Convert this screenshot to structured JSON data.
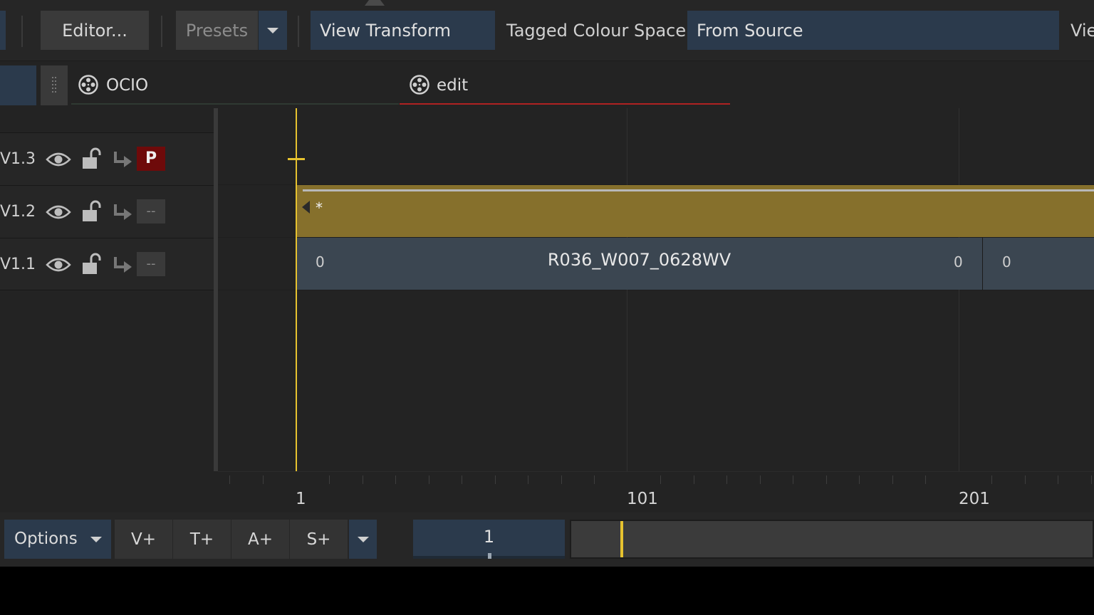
{
  "toolbar": {
    "editor_label": "Editor...",
    "presets_label": "Presets",
    "view_transform_value": "View Transform",
    "tagged_colour_space_label": "Tagged Colour Space",
    "tagged_colour_space_value": "From Source",
    "view_label_cut": "Vie"
  },
  "tabs": [
    {
      "label": "OCIO",
      "icon": "film-reel-icon"
    },
    {
      "label": "edit",
      "icon": "film-reel-icon",
      "active": true
    }
  ],
  "tracks": [
    {
      "name": "V1.3",
      "toggle": "P"
    },
    {
      "name": "V1.2",
      "toggle": "--"
    },
    {
      "name": "V1.1",
      "toggle": "--"
    }
  ],
  "clips": {
    "effect_clip": {
      "label": "*"
    },
    "video_clip": {
      "name": "R036_W007_0628WV",
      "in_handle": "0",
      "out_handle": "0"
    },
    "next_clip": {
      "in_handle": "0"
    }
  },
  "ruler": {
    "labels": [
      "1",
      "101",
      "201"
    ]
  },
  "bottom": {
    "options_label": "Options",
    "add_buttons": [
      "V+",
      "T+",
      "A+",
      "S+"
    ],
    "frame_value": "1"
  },
  "colors": {
    "playhead": "#e6c22f",
    "effect_clip": "#86702c",
    "video_clip": "#3b4651",
    "field_blue": "#2b3a4c",
    "record_red": "#6e0a0a"
  }
}
